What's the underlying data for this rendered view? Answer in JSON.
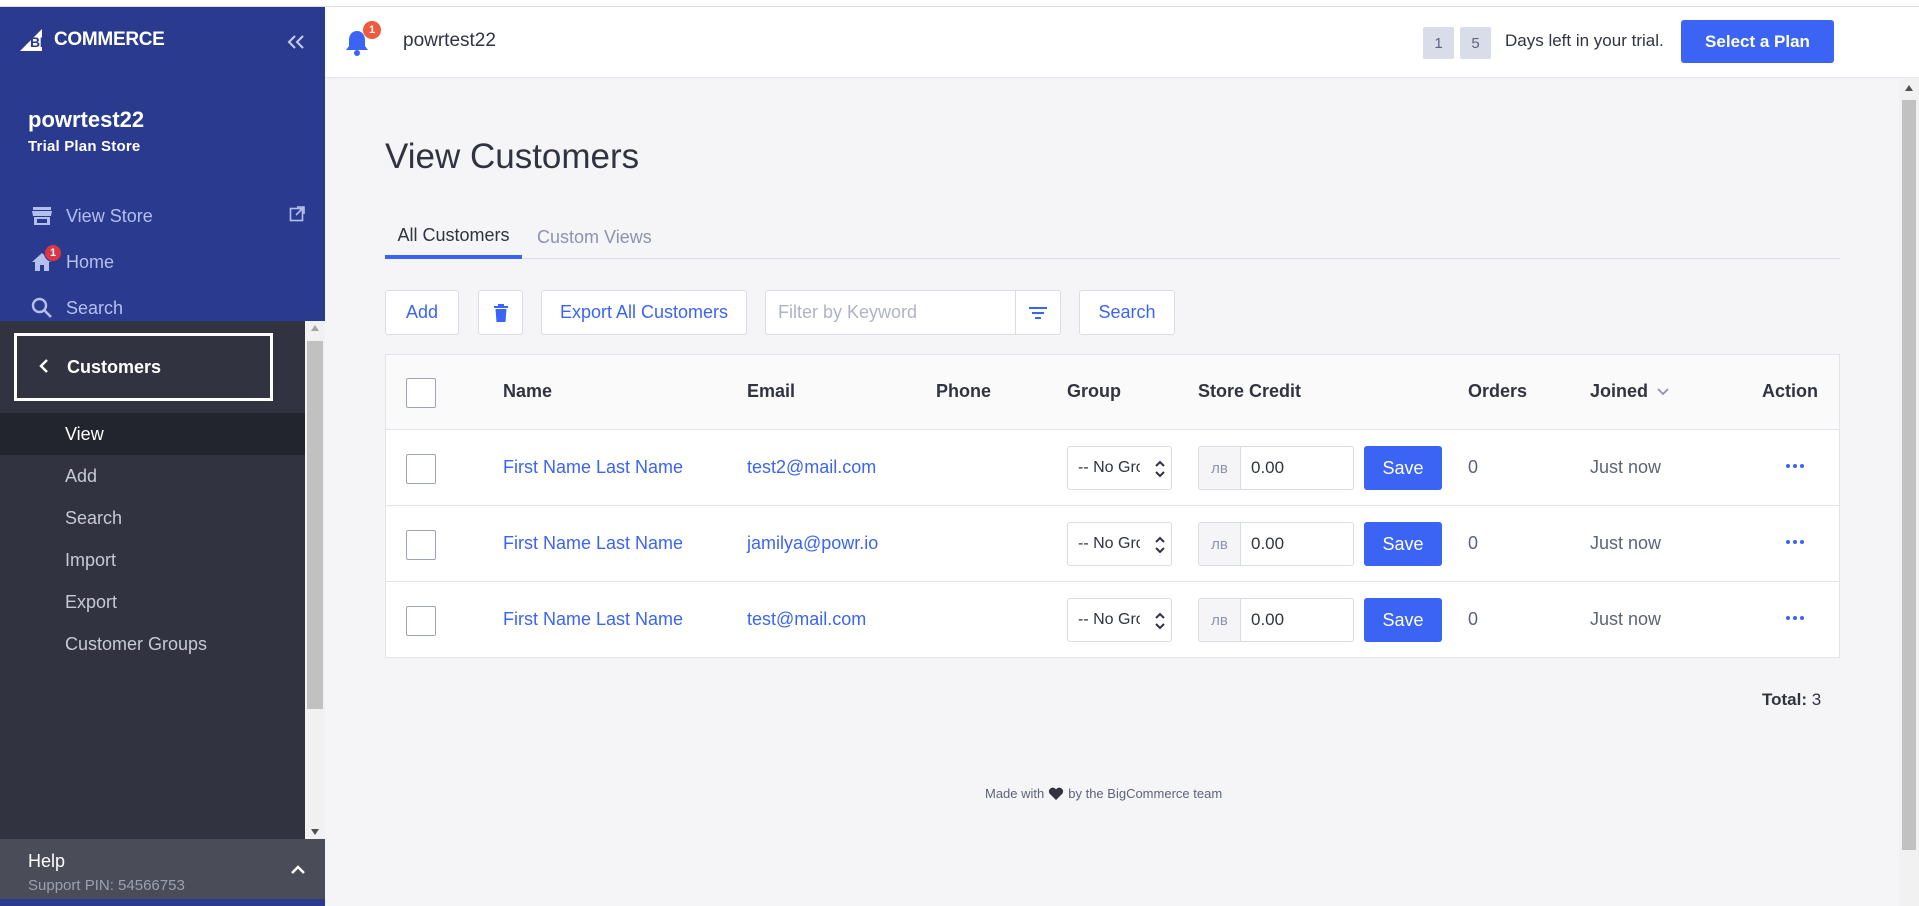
{
  "sidebar": {
    "logo_text": "COMMERCE",
    "logo_prefix": "BIG",
    "collapse_icon": "double-chevron-left-icon",
    "store_name": "powrtest22",
    "store_plan": "Trial Plan Store",
    "top_nav": [
      {
        "label": "View Store",
        "icon": "storefront-icon"
      },
      {
        "label": "Home",
        "icon": "home-icon",
        "badge": "1"
      },
      {
        "label": "Search",
        "icon": "search-icon"
      }
    ],
    "section_label": "Customers",
    "sub_items": [
      "View",
      "Add",
      "Search",
      "Import",
      "Export",
      "Customer Groups"
    ],
    "active_sub_item": "View",
    "help_title": "Help",
    "help_pin": "Support PIN: 54566753"
  },
  "header": {
    "notification_count": "1",
    "store_name": "powrtest22",
    "trial_days": [
      "1",
      "5"
    ],
    "trial_text": "Days left in your trial.",
    "plan_button": "Select a Plan"
  },
  "main": {
    "title": "View Customers",
    "tabs": [
      "All Customers",
      "Custom Views"
    ],
    "active_tab": "All Customers",
    "toolbar": {
      "add_label": "Add",
      "export_label": "Export All Customers",
      "filter_placeholder": "Filter by Keyword",
      "search_label": "Search"
    },
    "columns": [
      "Name",
      "Email",
      "Phone",
      "Group",
      "Store Credit",
      "Orders",
      "Joined",
      "Action"
    ],
    "rows": [
      {
        "name": "First Name Last Name",
        "email": "test2@mail.com",
        "phone": "",
        "group": "-- No Group --",
        "currency": "лв",
        "credit": "0.00",
        "save": "Save",
        "orders": "0",
        "joined": "Just now"
      },
      {
        "name": "First Name Last Name",
        "email": "jamilya@powr.io",
        "phone": "",
        "group": "-- No Group --",
        "currency": "лв",
        "credit": "0.00",
        "save": "Save",
        "orders": "0",
        "joined": "Just now"
      },
      {
        "name": "First Name Last Name",
        "email": "test@mail.com",
        "phone": "",
        "group": "-- No Group --",
        "currency": "лв",
        "credit": "0.00",
        "save": "Save",
        "orders": "0",
        "joined": "Just now"
      }
    ],
    "total_label": "Total:",
    "total_value": "3",
    "footer_left": "Made with",
    "footer_right": "by the BigCommerce team"
  },
  "colors": {
    "sidebar_bg": "#2a3b8f",
    "accent": "#3c64f4",
    "subnav_bg": "#313440"
  }
}
